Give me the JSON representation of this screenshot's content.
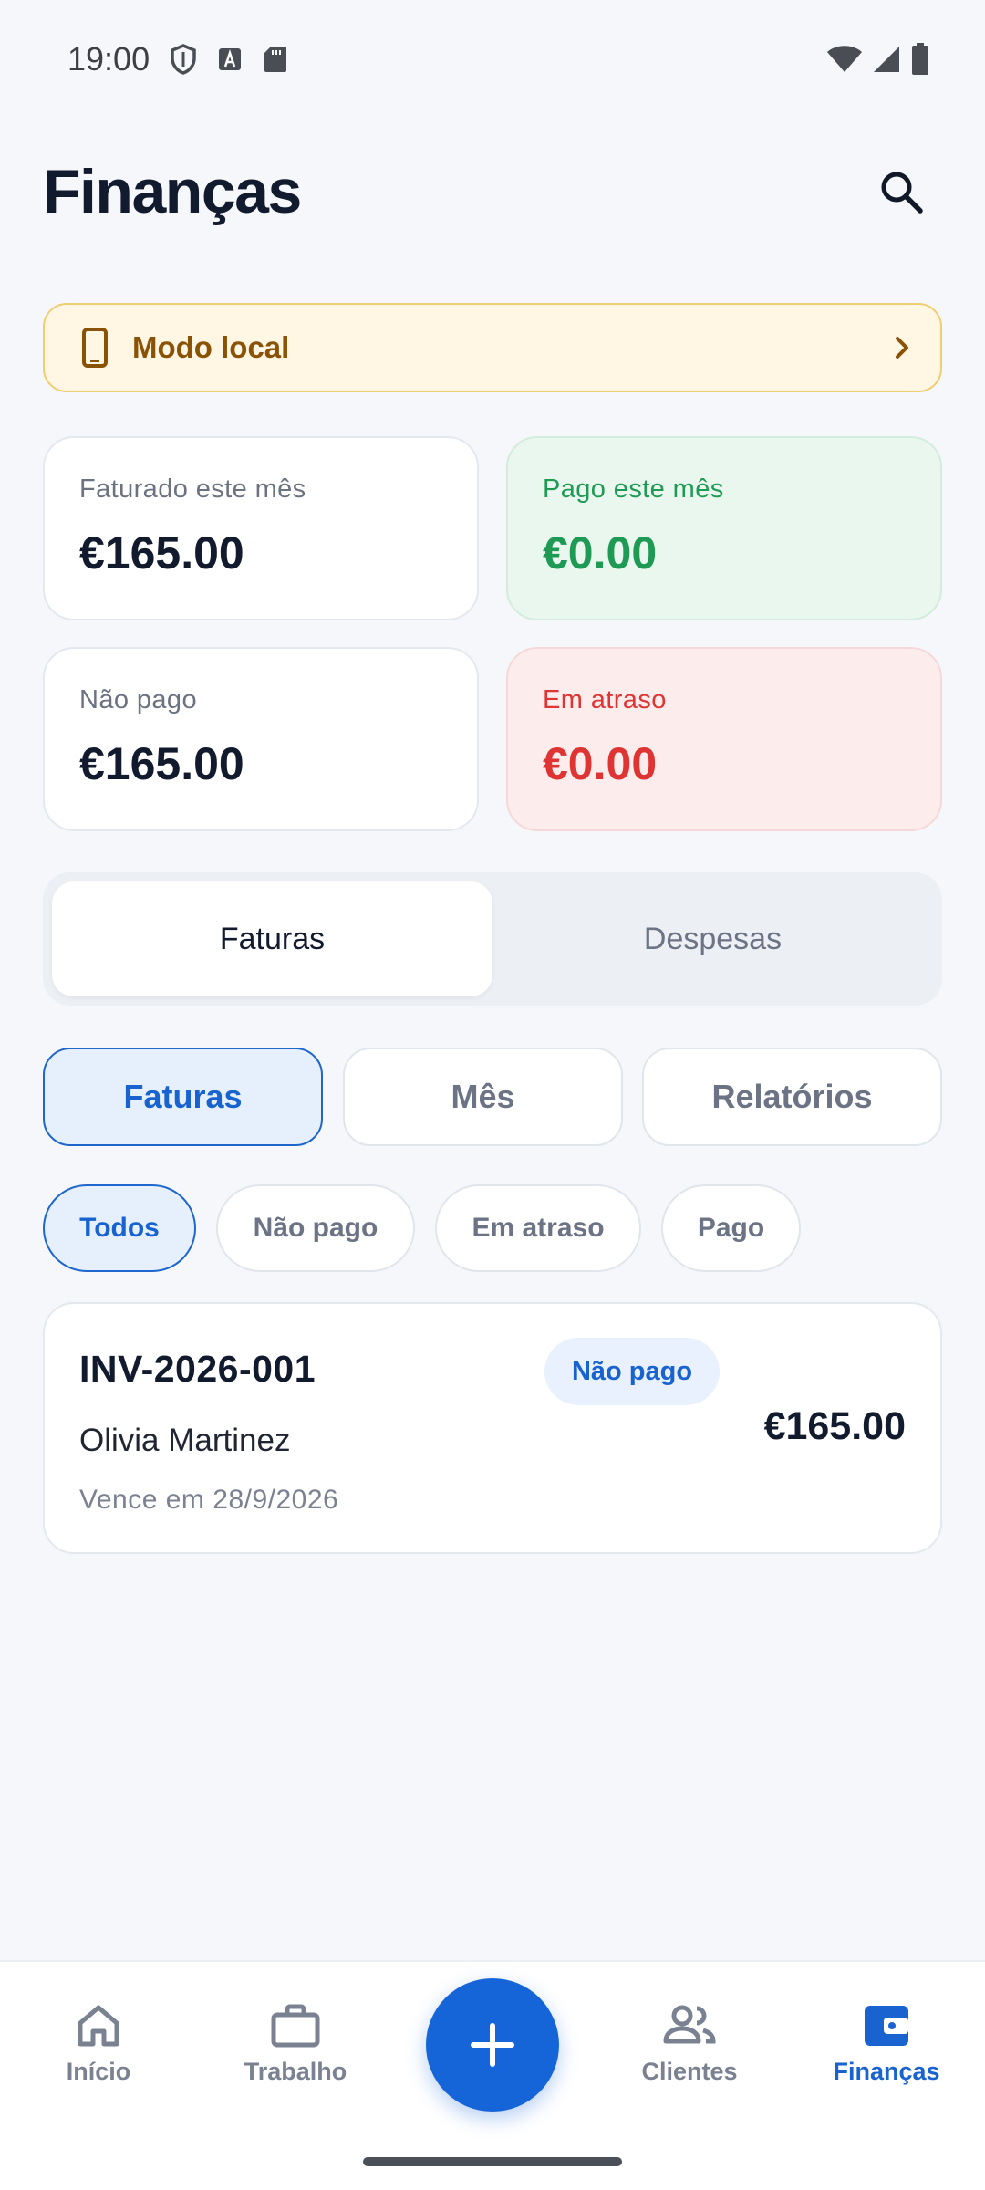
{
  "status_bar": {
    "time": "19:00"
  },
  "header": {
    "title": "Finanças"
  },
  "banner": {
    "label": "Modo local"
  },
  "stats": {
    "invoiced": {
      "label": "Faturado este mês",
      "value": "€165.00"
    },
    "paid": {
      "label": "Pago este mês",
      "value": "€0.00"
    },
    "unpaid": {
      "label": "Não pago",
      "value": "€165.00"
    },
    "overdue": {
      "label": "Em atraso",
      "value": "€0.00"
    }
  },
  "segments": {
    "invoices": "Faturas",
    "expenses": "Despesas",
    "active": "Faturas"
  },
  "subtabs": {
    "invoices": "Faturas",
    "month": "Mês",
    "reports": "Relatórios",
    "active": "Faturas"
  },
  "filters": {
    "all": "Todos",
    "unpaid": "Não pago",
    "overdue": "Em atraso",
    "paid": "Pago",
    "active": "Todos"
  },
  "invoices": [
    {
      "number": "INV-2026-001",
      "client": "Olivia Martinez",
      "due": "Vence em 28/9/2026",
      "status": "Não pago",
      "amount": "€165.00"
    }
  ],
  "nav": {
    "home": "Início",
    "work": "Trabalho",
    "clients": "Clientes",
    "finance": "Finanças",
    "active": "Finanças"
  },
  "colors": {
    "accent": "#1565d8",
    "paid": "#1f9a55",
    "overdue": "#df3434",
    "banner_text": "#8a5205"
  }
}
